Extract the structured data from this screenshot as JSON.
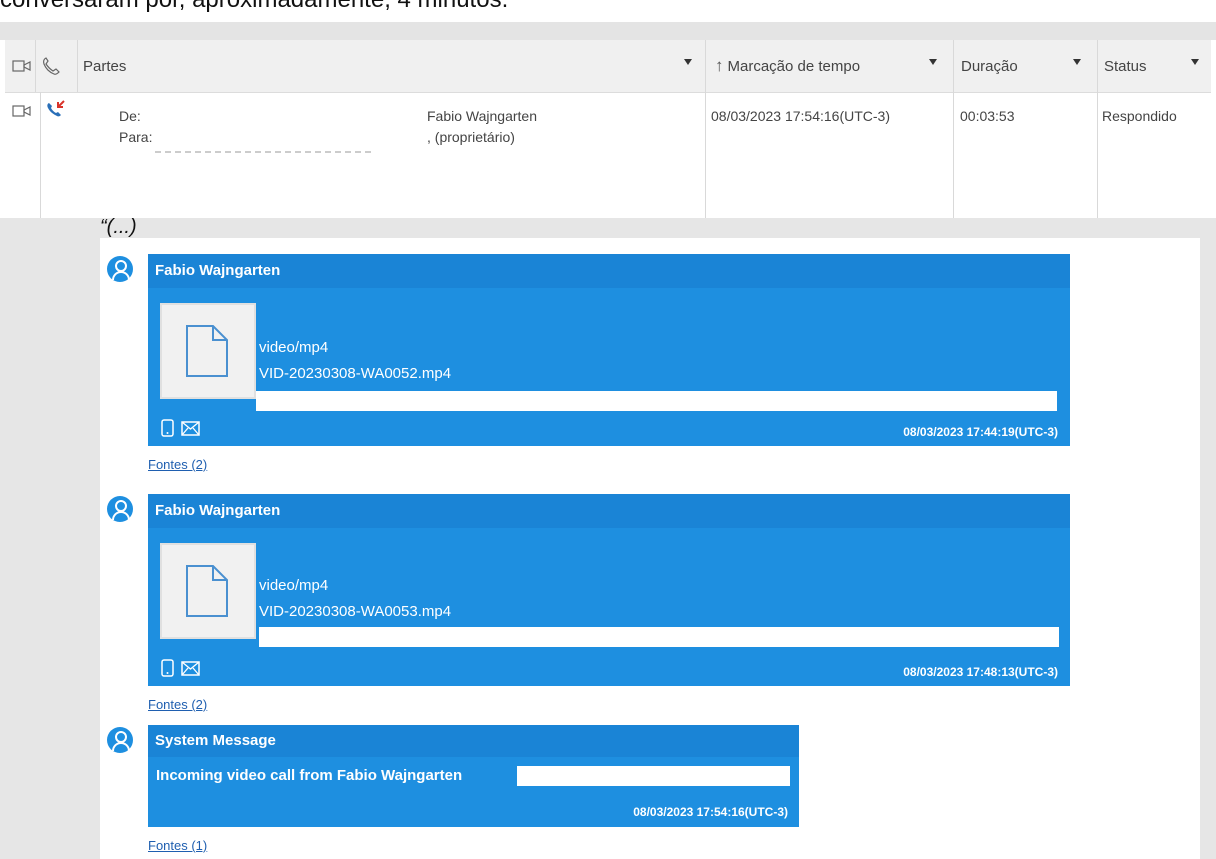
{
  "caption": "conversaram por, aproximadamente, 4 minutos.",
  "table": {
    "columns": {
      "parties": "Partes",
      "timestamp": "Marcação de tempo",
      "duration": "Duração",
      "status": "Status"
    },
    "row": {
      "from_label": "De:",
      "to_label": "Para:",
      "from_value": "Fabio  Wajngarten",
      "to_value": ", (proprietário)",
      "timestamp": "08/03/2023 17:54:16(UTC-3)",
      "duration": "00:03:53",
      "status": "Respondido"
    }
  },
  "chat": {
    "ellipsis": "“(...)",
    "messages": [
      {
        "sender": "Fabio  Wajngarten",
        "file_type": "video/mp4",
        "file_name": "VID-20230308-WA0052.mp4",
        "timestamp": "08/03/2023 17:44:19(UTC-3)",
        "sources": "Fontes (2)"
      },
      {
        "sender": "Fabio  Wajngarten",
        "file_type": "video/mp4",
        "file_name": "VID-20230308-WA0053.mp4",
        "timestamp": "08/03/2023 17:48:13(UTC-3)",
        "sources": "Fontes (2)"
      },
      {
        "sender": "System Message",
        "text": "Incoming video call from Fabio  Wajngarten",
        "timestamp": "08/03/2023 17:54:16(UTC-3)",
        "sources": "Fontes (1)"
      }
    ]
  },
  "icons": {
    "video": "video-camera-icon",
    "phone": "phone-icon",
    "incoming_call": "incoming-call-icon",
    "file": "file-icon",
    "device": "phone-device-icon",
    "envelope": "envelope-icon",
    "avatar": "user-avatar-icon"
  },
  "colors": {
    "bubble": "#1e8fe0",
    "link": "#1f5fb0",
    "header_bg": "#f0f0f0"
  }
}
